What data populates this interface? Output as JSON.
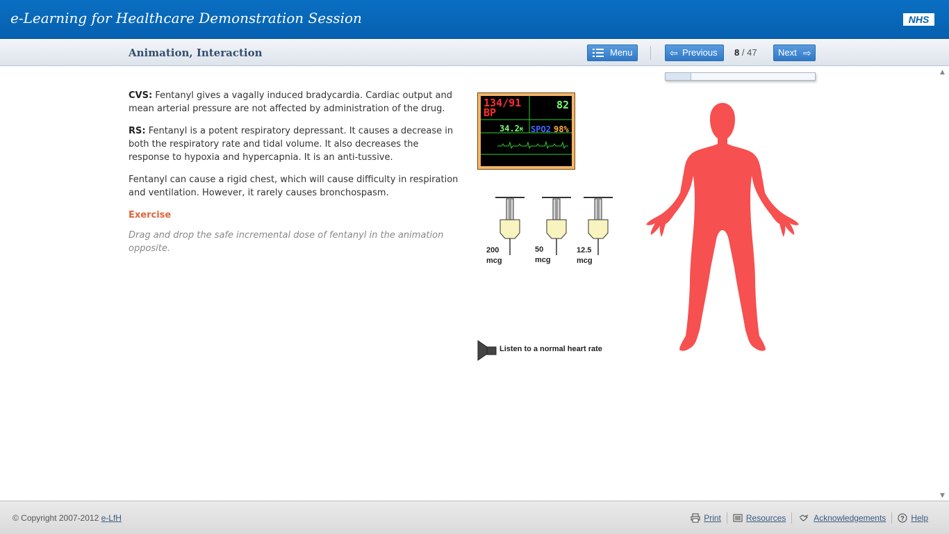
{
  "header": {
    "title": "e-Learning for Healthcare Demonstration Session",
    "logo_text": "NHS"
  },
  "navbar": {
    "page_title": "Animation, Interaction",
    "menu_label": "Menu",
    "previous_label": "Previous",
    "next_label": "Next",
    "current_page": "8",
    "page_separator": "/",
    "total_pages": "47",
    "progress_fraction": 0.17
  },
  "content": {
    "cvs_label": "CVS:",
    "cvs_text": " Fentanyl gives a vagally induced bradycardia. Cardiac output and mean arterial pressure are not affected by administration of the drug.",
    "rs_label": "RS:",
    "rs_text": " Fentanyl is a potent respiratory depressant. It causes a decrease in both the respiratory rate and tidal volume. It also decreases the response to hypoxia and hypercapnia. It is an anti-tussive.",
    "rigid_chest_text": "Fentanyl can cause a rigid chest, which will cause difficulty in respiration and ventilation. However, it rarely causes bronchospasm.",
    "exercise_title": "Exercise",
    "exercise_text": "Drag and drop the safe incremental dose of fentanyl in the animation opposite."
  },
  "monitor": {
    "bp_value": "134/91",
    "bp_label": "BP",
    "heart_rate": "82",
    "resp_value": "34.2",
    "resp_unit": "M",
    "spo2_label": "SPO2",
    "spo2_value": "98%"
  },
  "syringes": [
    {
      "dose": "200",
      "unit": "mcg"
    },
    {
      "dose": "50",
      "unit": "mcg"
    },
    {
      "dose": "12.5",
      "unit": "mcg"
    }
  ],
  "audio": {
    "label": "Listen to a normal heart rate"
  },
  "colors": {
    "header_blue": "#0660b0",
    "button_blue": "#2f79c6",
    "exercise_orange": "#e0643a",
    "body_red": "#f65050",
    "monitor_frame": "#f6b566"
  },
  "footer": {
    "copyright_prefix": "© Copyright 2007-2012 ",
    "copyright_link": "e-LfH",
    "links": [
      {
        "label": "Print",
        "icon": "printer-icon"
      },
      {
        "label": "Resources",
        "icon": "document-icon"
      },
      {
        "label": "Acknowledgements",
        "icon": "handshake-icon"
      },
      {
        "label": "Help",
        "icon": "help-icon"
      }
    ]
  }
}
